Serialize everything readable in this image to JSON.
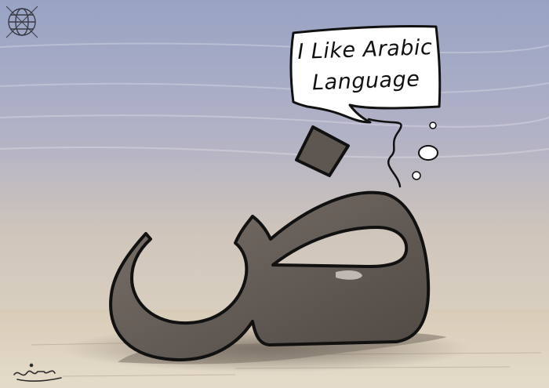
{
  "caption": {
    "line1": "I Like Arabic",
    "line2": "Language"
  },
  "logo": {
    "name": "globe-logo"
  },
  "signature": {
    "name": "artist-signature"
  },
  "colors": {
    "sky_top": "#9ea8c6",
    "sky_mid": "#b9b9c9",
    "ground": "#ddd1bd",
    "letter_fill": "#6e665f",
    "outline": "#111111",
    "bubble": "#ffffff"
  }
}
